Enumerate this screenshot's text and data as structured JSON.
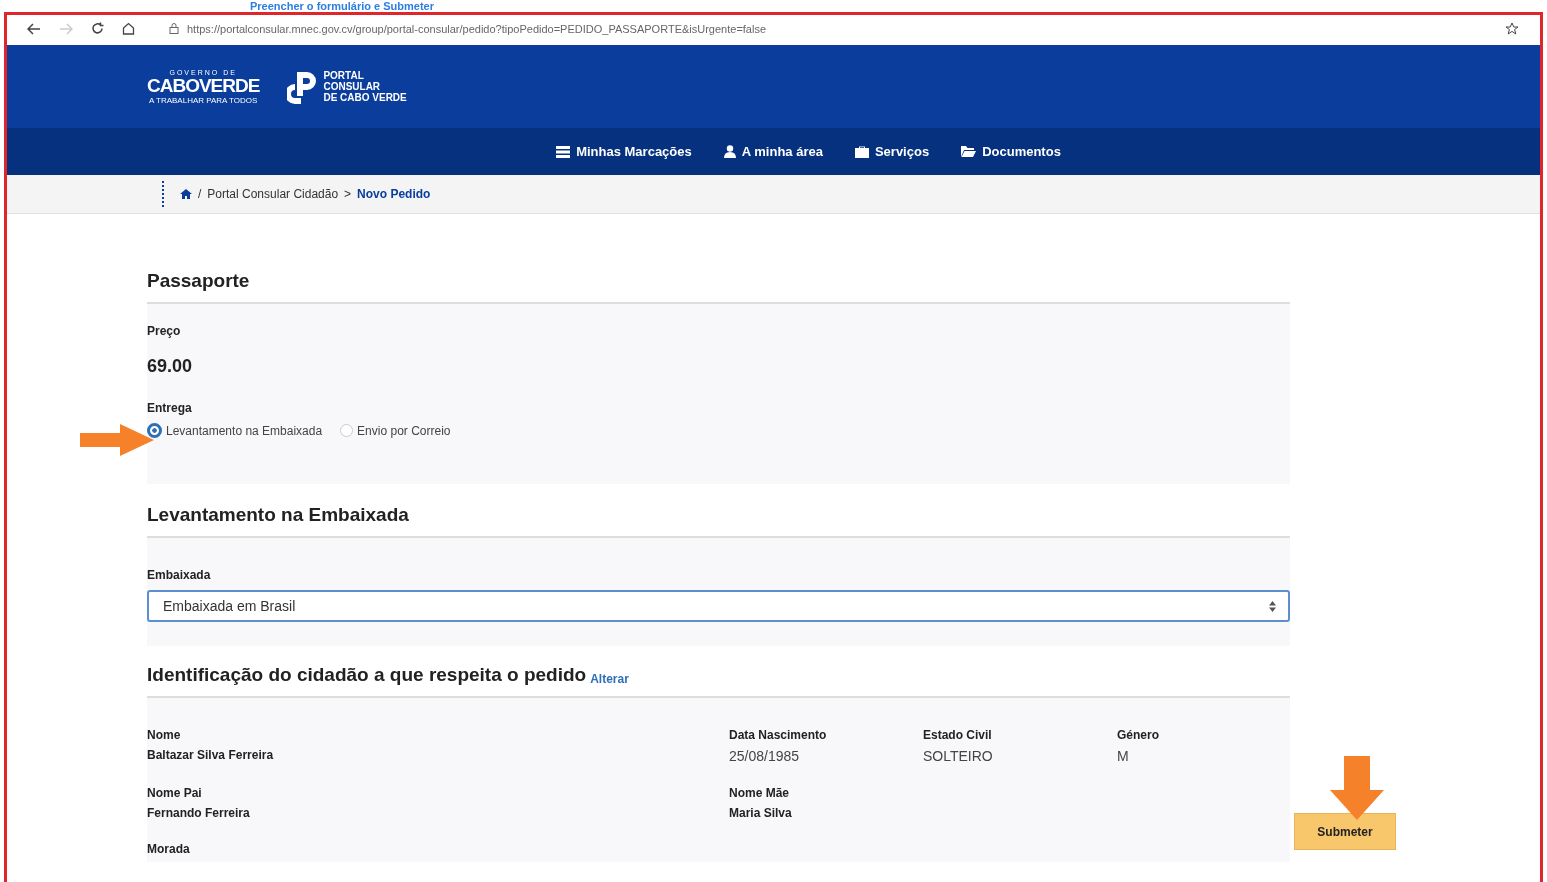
{
  "caption": "Preencher o formulário e Submeter",
  "browser": {
    "url": "https://portalconsular.mnec.gov.cv/group/portal-consular/pedido?tipoPedido=PEDIDO_PASSAPORTE&isUrgente=false"
  },
  "header": {
    "logo_top": "GOVERNO DE",
    "logo_main": "CABOVERDE",
    "logo_sub": "A TRABALHAR PARA TODOS",
    "portal_lines": [
      "PORTAL",
      "CONSULAR",
      "DE CABO VERDE"
    ]
  },
  "nav": [
    {
      "label": "Minhas Marcações",
      "kind": "list"
    },
    {
      "label": "A minha área",
      "kind": "user"
    },
    {
      "label": "Serviços",
      "kind": "briefcase"
    },
    {
      "label": "Documentos",
      "kind": "folder"
    }
  ],
  "breadcrumb": {
    "home_separator": "/",
    "items": [
      "Portal Consular Cidadão",
      "Novo Pedido"
    ],
    "separator": ">"
  },
  "passaporte": {
    "title": "Passaporte",
    "price_label": "Preço",
    "price": "69.00",
    "delivery_label": "Entrega",
    "options": [
      {
        "label": "Levantamento na Embaixada",
        "selected": true
      },
      {
        "label": "Envio por Correio",
        "selected": false
      }
    ]
  },
  "embassy": {
    "title": "Levantamento na Embaixada",
    "field_label": "Embaixada",
    "value": "Embaixada em Brasil"
  },
  "identity": {
    "title": "Identificação do cidadão a que respeita o pedido",
    "link": "Alterar",
    "rows": [
      [
        {
          "label": "Nome",
          "value": "Baltazar Silva Ferreira",
          "bold": true
        },
        {
          "label": "Data Nascimento",
          "value": "25/08/1985",
          "bold": false
        },
        {
          "label": "Estado Civil",
          "value": "SOLTEIRO",
          "bold": false
        },
        {
          "label": "Género",
          "value": "M",
          "bold": false
        }
      ],
      [
        {
          "label": "Nome Pai",
          "value": "Fernando Ferreira",
          "bold": true
        },
        {
          "label": "Nome Mãe",
          "value": "Maria Silva",
          "bold": true
        }
      ],
      [
        {
          "label": "Morada"
        }
      ]
    ]
  },
  "submit": "Submeter"
}
